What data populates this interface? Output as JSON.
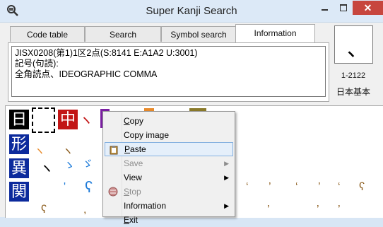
{
  "window": {
    "title": "Super Kanji Search",
    "close_glyph": "✕"
  },
  "tabs": [
    {
      "label": "Code table",
      "active": false
    },
    {
      "label": "Search",
      "active": false
    },
    {
      "label": "Symbol search",
      "active": false
    },
    {
      "label": "Information",
      "active": true
    }
  ],
  "info": {
    "line1": "JISX0208(第1)1区2点(S:8141  E:A1A2  U:3001)",
    "line2": "記号(句読):",
    "line3": "全角読点、IDEOGRAPHIC COMMA"
  },
  "preview": {
    "char": "、",
    "code": "1-2122",
    "standard": "日本基本"
  },
  "radicals": {
    "r1": "日",
    "r1b": "中",
    "r2": "形",
    "r3": "異",
    "r4": "関"
  },
  "context_menu": {
    "items": [
      {
        "label": "Copy",
        "underline": "C",
        "rest": "opy"
      },
      {
        "label": "Copy image"
      },
      {
        "label": "Paste",
        "underline": "P",
        "rest": "aste",
        "highlighted": true
      },
      {
        "label": "Save",
        "disabled": true,
        "submenu": true
      },
      {
        "label": "View",
        "submenu": true
      },
      {
        "label": "Stop",
        "underline": "S",
        "rest": "top",
        "disabled": true
      },
      {
        "label": "Information",
        "submenu": true
      },
      {
        "label": "Exit",
        "underline": "E",
        "rest": "xit"
      }
    ]
  },
  "colors": {
    "accent": "#0c2a9c",
    "close": "#c7463e",
    "highlight": "#e5effa"
  }
}
